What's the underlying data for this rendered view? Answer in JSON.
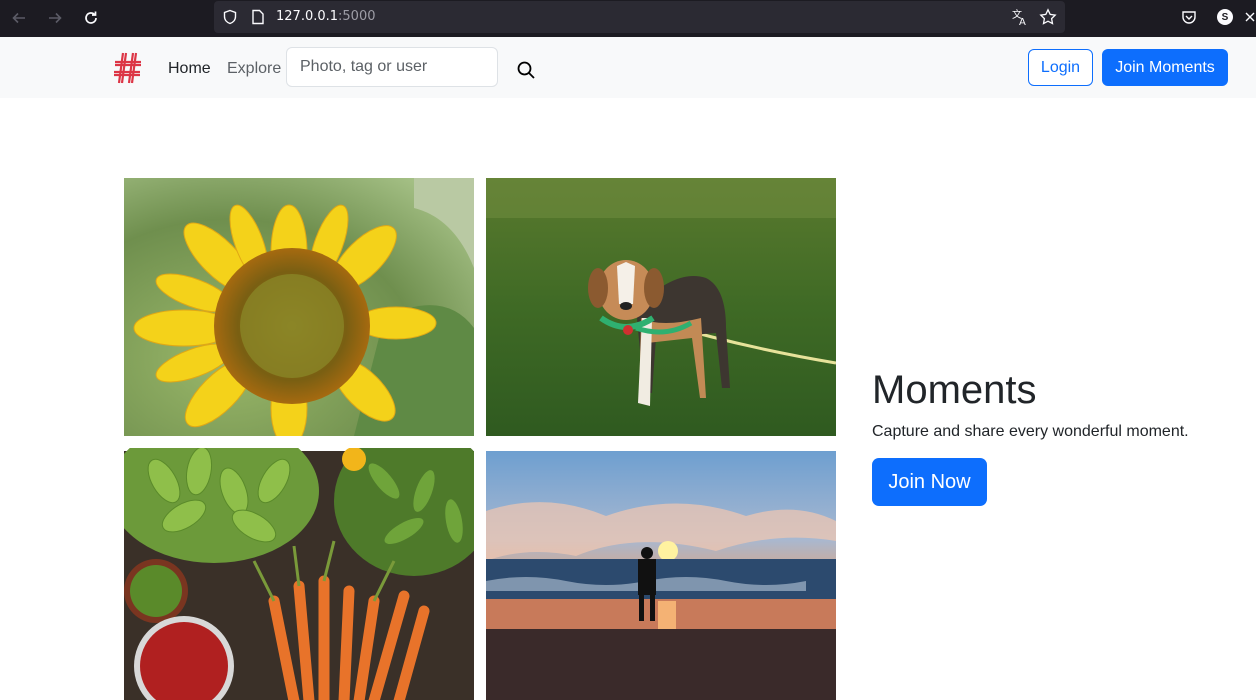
{
  "browser": {
    "url_host": "127.0.0.1",
    "url_port": ":5000",
    "profile_initial": "S"
  },
  "navbar": {
    "brand_icon": "hash-logo",
    "home_label": "Home",
    "explore_label": "Explore",
    "search_placeholder": "Photo, tag or user",
    "search_value": "",
    "login_label": "Login",
    "join_label": "Join Moments"
  },
  "photos": [
    {
      "subject": "sunflower"
    },
    {
      "subject": "beagle on leash in grass"
    },
    {
      "subject": "vegetables: bitter gourds, cucumbers, chilies, carrots"
    },
    {
      "subject": "person on beach at sunset"
    }
  ],
  "hero": {
    "title": "Moments",
    "subtitle": "Capture and share every wonderful moment.",
    "cta_label": "Join Now"
  },
  "colors": {
    "primary": "#0d6efd",
    "navbar_bg": "#f8f9fa",
    "brand_red": "#dc3545",
    "browser_bg": "#1c1b22"
  }
}
